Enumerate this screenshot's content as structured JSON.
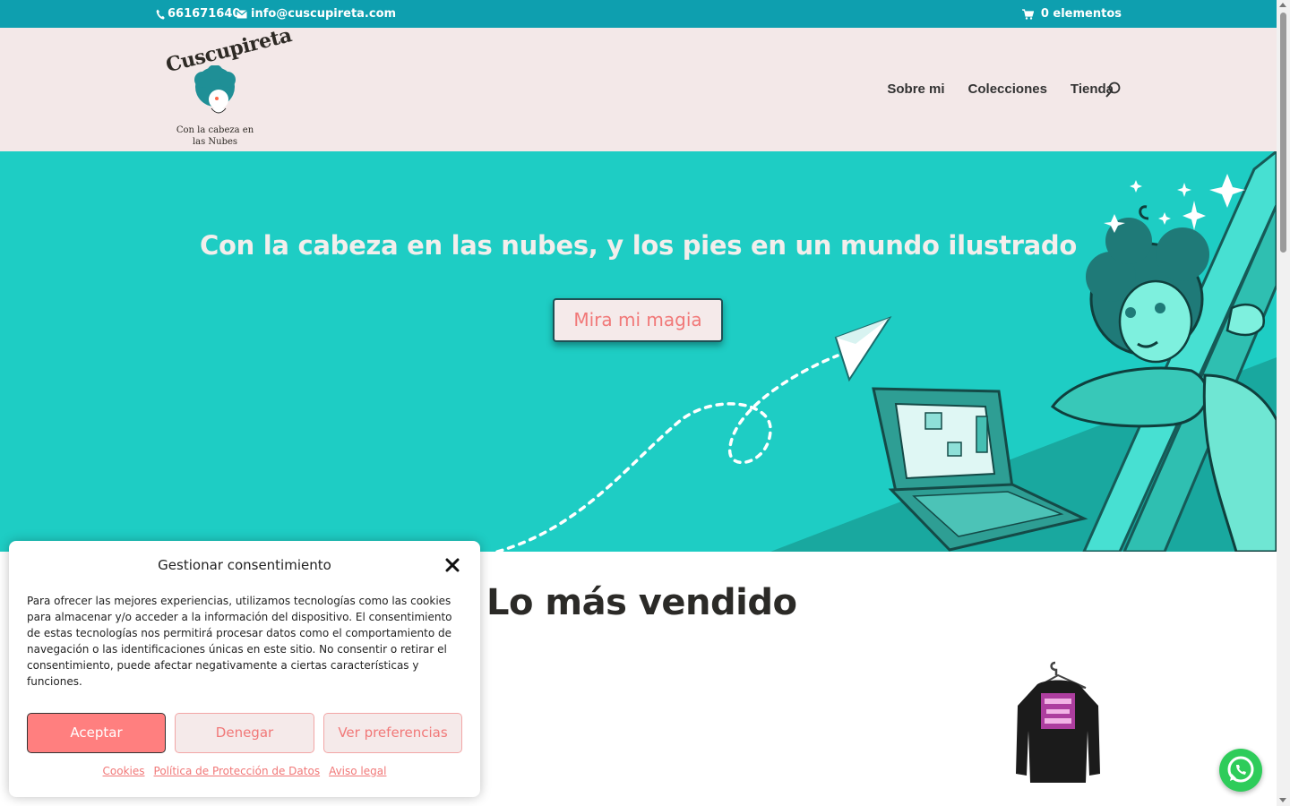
{
  "topbar": {
    "phone": "661671640",
    "email": "info@cuscupireta.com",
    "cart_label": "0 elementos"
  },
  "header": {
    "logo_wordmark": "Cuscupireta",
    "logo_tagline_line1": "Con la cabeza en",
    "logo_tagline_line2": "las Nubes",
    "nav": [
      "Sobre mi",
      "Colecciones",
      "Tienda"
    ]
  },
  "hero": {
    "title": "Con la cabeza en las nubes, y los pies en un mundo ilustrado",
    "cta_label": "Mira mi magia"
  },
  "section": {
    "title": "Lo más vendido"
  },
  "consent": {
    "title": "Gestionar consentimiento",
    "body": "Para ofrecer las mejores experiencias, utilizamos tecnologías como las cookies para almacenar y/o acceder a la información del dispositivo. El consentimiento de estas tecnologías nos permitirá procesar datos como el comportamiento de navegación o las identificaciones únicas en este sitio. No consentir o retirar el consentimiento, puede afectar negativamente a ciertas características y funciones.",
    "accept_label": "Aceptar",
    "deny_label": "Denegar",
    "prefs_label": "Ver preferencias",
    "links": [
      "Cookies",
      "Política de Protección de Datos",
      "Aviso legal"
    ]
  },
  "icons": {
    "phone": "phone-icon",
    "email": "envelope-icon",
    "cart": "cart-icon",
    "search": "search-icon",
    "close": "close-icon",
    "whatsapp": "whatsapp-icon"
  },
  "colors": {
    "topbar": "#0e9faf",
    "header": "#f3e8e8",
    "hero": "#1ecdc4",
    "accent": "#ff7f7f",
    "accent_text": "#f17878"
  }
}
